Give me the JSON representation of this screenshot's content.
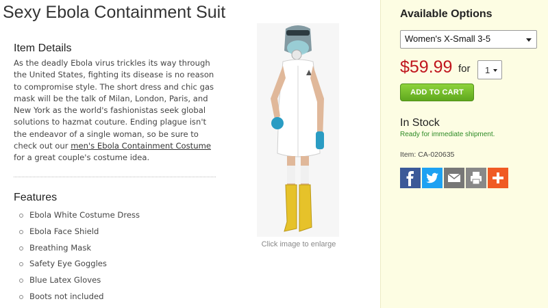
{
  "product": {
    "title": "Sexy Ebola Containment Suit",
    "item_details_heading": "Item Details",
    "description_part1": "As the deadly Ebola virus trickles its way through the United States, fighting its disease is no reason to compromise style. The short dress and chic gas mask will be the talk of Milan, London, Paris, and New York as the world's fashionistas seek global solutions to hazmat couture. Ending plague isn't the endeavor of a single woman, so be sure to check out our ",
    "description_link": "men's Ebola Containment Costume",
    "description_part2": " for a great couple's costume idea.",
    "features_heading": "Features",
    "features": [
      "Ebola White Costume Dress",
      "Ebola Face Shield",
      "Breathing Mask",
      "Safety Eye Goggles",
      "Blue Latex Gloves",
      "Boots not included"
    ],
    "image_caption": "Click image to enlarge"
  },
  "options": {
    "heading": "Available Options",
    "size_selected": "Women's X-Small 3-5",
    "price": "$59.99",
    "for_label": "for",
    "quantity": "1",
    "add_to_cart": "ADD TO CART",
    "stock_status": "In Stock",
    "shipping_note": "Ready for immediate shipment.",
    "item_number": "Item: CA-020635"
  },
  "share_icons": [
    "facebook-icon",
    "twitter-icon",
    "email-icon",
    "print-icon",
    "plus-icon"
  ],
  "colors": {
    "price": "#c0161e",
    "sidebar_bg": "#fdfde3",
    "add_to_cart": "#6dbb2a",
    "ready_text": "#2c8a24"
  }
}
